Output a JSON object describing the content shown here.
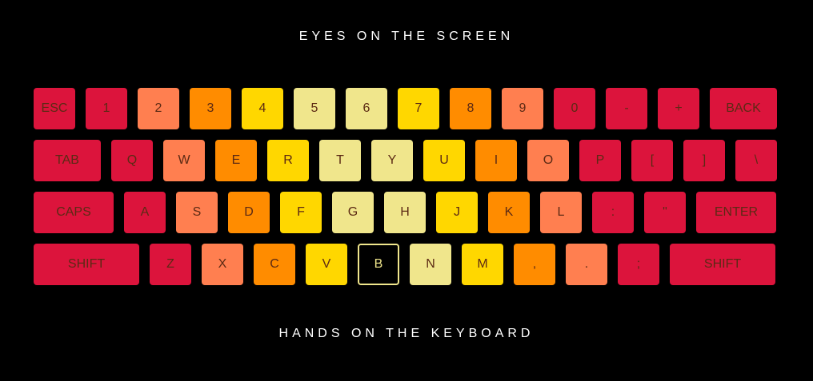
{
  "header": {
    "title": "EYES ON THE SCREEN"
  },
  "footer": {
    "title": "HANDS ON THE KEYBOARD"
  },
  "colors": {
    "red": "#dc143c",
    "coral": "#ff7f50",
    "orange": "#ff8c00",
    "gold": "#ffd700",
    "khaki": "#f0e68c",
    "background": "#000000",
    "active_border": "#f0e68c"
  },
  "keyboard": {
    "active_key": "B",
    "rows": [
      {
        "keys": [
          "ESC",
          "1",
          "2",
          "3",
          "4",
          "5",
          "6",
          "7",
          "8",
          "9",
          "0",
          "-",
          "+",
          "BACK"
        ]
      },
      {
        "keys": [
          "TAB",
          "Q",
          "W",
          "E",
          "R",
          "T",
          "Y",
          "U",
          "I",
          "O",
          "P",
          "[",
          "]",
          "\\"
        ]
      },
      {
        "keys": [
          "CAPS",
          "A",
          "S",
          "D",
          "F",
          "G",
          "H",
          "J",
          "K",
          "L",
          ":",
          "\"",
          "ENTER"
        ]
      },
      {
        "keys": [
          "SHIFT",
          "Z",
          "X",
          "C",
          "V",
          "B",
          "N",
          "M",
          ",",
          ".",
          ";",
          "SHIFT"
        ]
      }
    ]
  }
}
